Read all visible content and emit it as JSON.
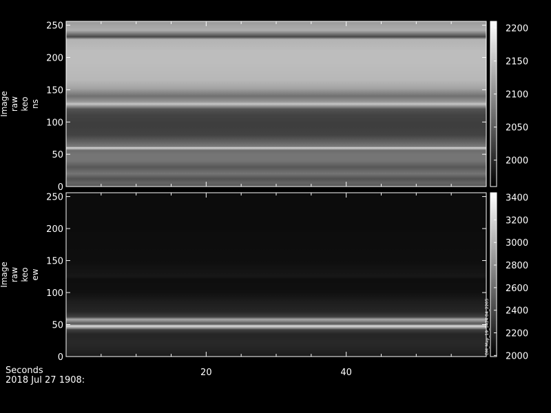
{
  "chart_data": [
    {
      "type": "heatmap",
      "ylabel_lines": [
        "Image",
        "raw",
        "keo",
        "ns"
      ],
      "ylim": [
        0,
        256
      ],
      "yticks": [
        0,
        50,
        100,
        150,
        200,
        250
      ],
      "xlim": [
        0,
        60
      ],
      "colorbar": {
        "range": [
          1960,
          2210
        ],
        "ticks": [
          2000,
          2050,
          2100,
          2150,
          2200
        ],
        "colormap": "grayscale"
      },
      "profile": {
        "y": [
          0,
          5,
          12,
          20,
          30,
          40,
          50,
          56,
          60,
          62,
          68,
          80,
          95,
          110,
          120,
          125,
          128,
          131,
          140,
          152,
          165,
          190,
          210,
          228,
          232,
          236,
          242,
          250,
          256
        ],
        "value": [
          2040,
          2060,
          2040,
          2075,
          2045,
          2075,
          2075,
          2065,
          2170,
          2080,
          2060,
          2025,
          2020,
          2025,
          2040,
          2110,
          2155,
          2110,
          2070,
          2120,
          2140,
          2145,
          2145,
          2135,
          2030,
          2070,
          2130,
          2120,
          2110
        ]
      }
    },
    {
      "type": "heatmap",
      "ylabel_lines": [
        "Image",
        "raw",
        "keo",
        "ew"
      ],
      "ylim": [
        0,
        256
      ],
      "yticks": [
        0,
        50,
        100,
        150,
        200,
        250
      ],
      "xlim": [
        0,
        60
      ],
      "xticks": [
        20,
        40
      ],
      "colorbar": {
        "range": [
          1990,
          3440
        ],
        "ticks": [
          2000,
          2200,
          2400,
          2600,
          2800,
          3000,
          3200,
          3400
        ],
        "colormap": "grayscale"
      },
      "colorbar_annotation": "DM_Map_19_1424.04_2205",
      "profile": {
        "y": [
          0,
          5,
          20,
          35,
          42,
          45,
          48,
          50,
          52,
          55,
          58,
          62,
          70,
          85,
          100,
          121,
          125,
          150,
          200,
          256
        ],
        "value": [
          2130,
          2170,
          2220,
          2200,
          2350,
          2900,
          3250,
          2650,
          2500,
          2750,
          2950,
          2350,
          2200,
          2160,
          2080,
          2070,
          2120,
          2070,
          2060,
          2060
        ]
      }
    }
  ],
  "xaxis": {
    "label": "Seconds",
    "date": "2018 Jul 27 1908:"
  }
}
